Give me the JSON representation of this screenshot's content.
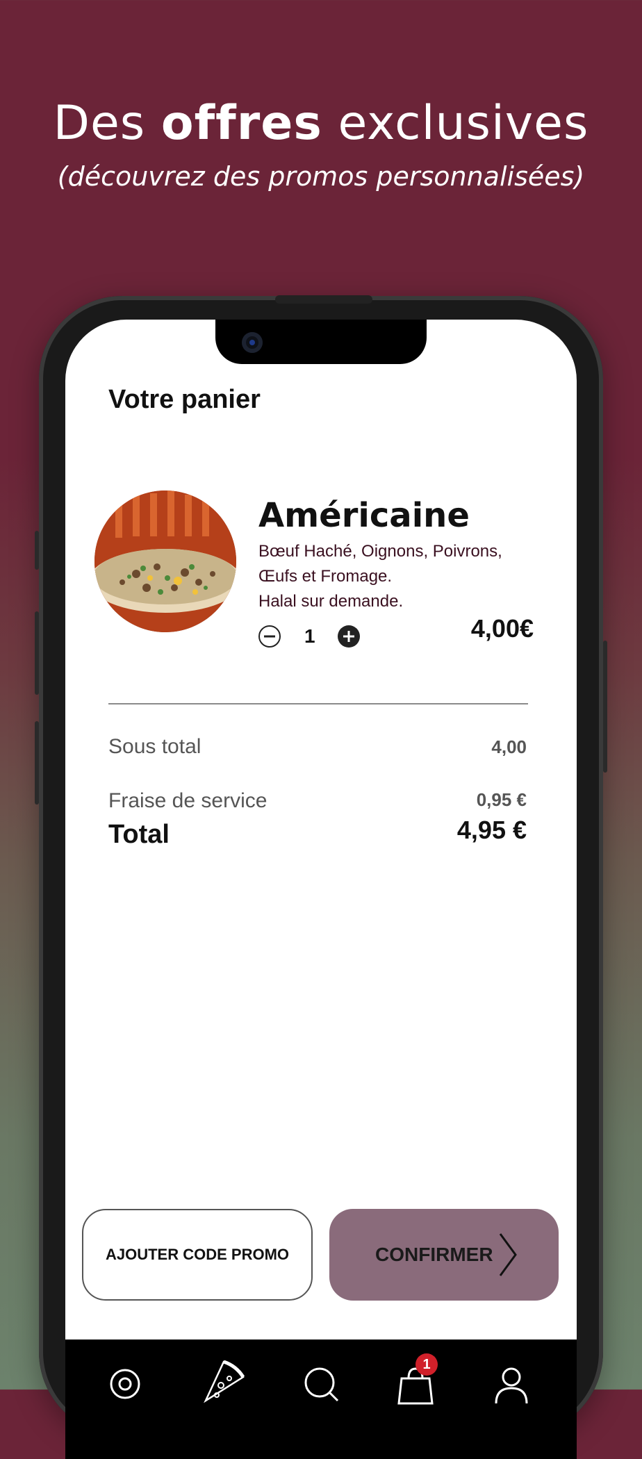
{
  "header": {
    "title_prefix": "Des ",
    "title_bold": "offres",
    "title_suffix": " exclusives",
    "subtitle": "(découvrez des promos personnalisées)"
  },
  "cart": {
    "title": "Votre panier",
    "item": {
      "name": "Américaine",
      "description_lines": [
        "Bœuf Haché, Oignons, Poivrons,",
        "Œufs et Fromage.",
        "Halal sur demande."
      ],
      "quantity": "1",
      "price": "4,00€"
    },
    "summary": {
      "subtotal_label": "Sous total",
      "subtotal_value": "4,00",
      "service_label": "Fraise de service",
      "service_value": "0,95 €",
      "total_label": "Total",
      "total_value": "4,95 €"
    },
    "buttons": {
      "promo": "AJOUTER CODE PROMO",
      "confirm": "CONFIRMER"
    }
  },
  "tabbar": {
    "items": [
      {
        "icon": "location-icon"
      },
      {
        "icon": "pizza-icon"
      },
      {
        "icon": "search-icon"
      },
      {
        "icon": "bag-icon",
        "badge": "1"
      },
      {
        "icon": "profile-icon"
      }
    ]
  },
  "colors": {
    "background_top": "#6b2438",
    "background_bottom": "#6c826c",
    "confirm_button": "#8a6b7b",
    "badge": "#d0202a"
  }
}
